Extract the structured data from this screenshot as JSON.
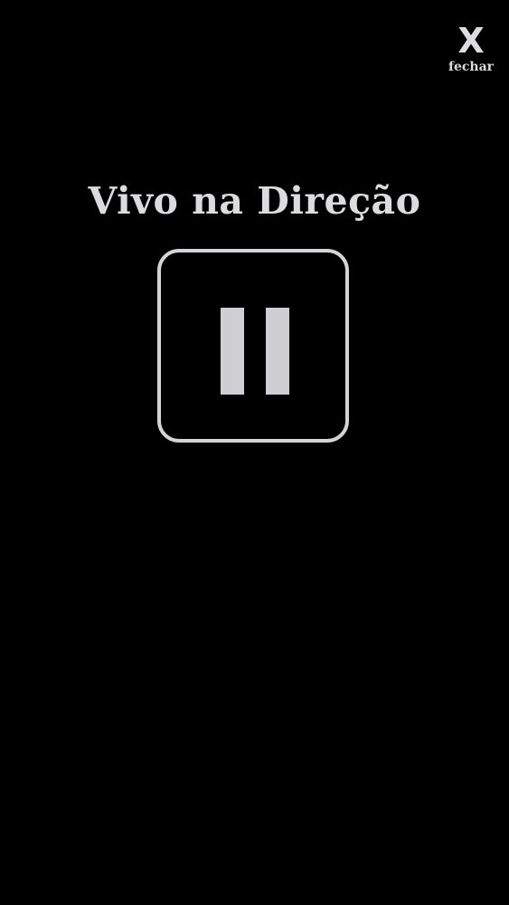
{
  "close": {
    "icon": "close-x-icon",
    "glyph": "X",
    "label": "fechar"
  },
  "title": "Vivo na Direção",
  "player": {
    "state": "playing",
    "control_icon": "pause-icon"
  },
  "colors": {
    "background": "#000000",
    "foreground": "#dcdcdf"
  }
}
